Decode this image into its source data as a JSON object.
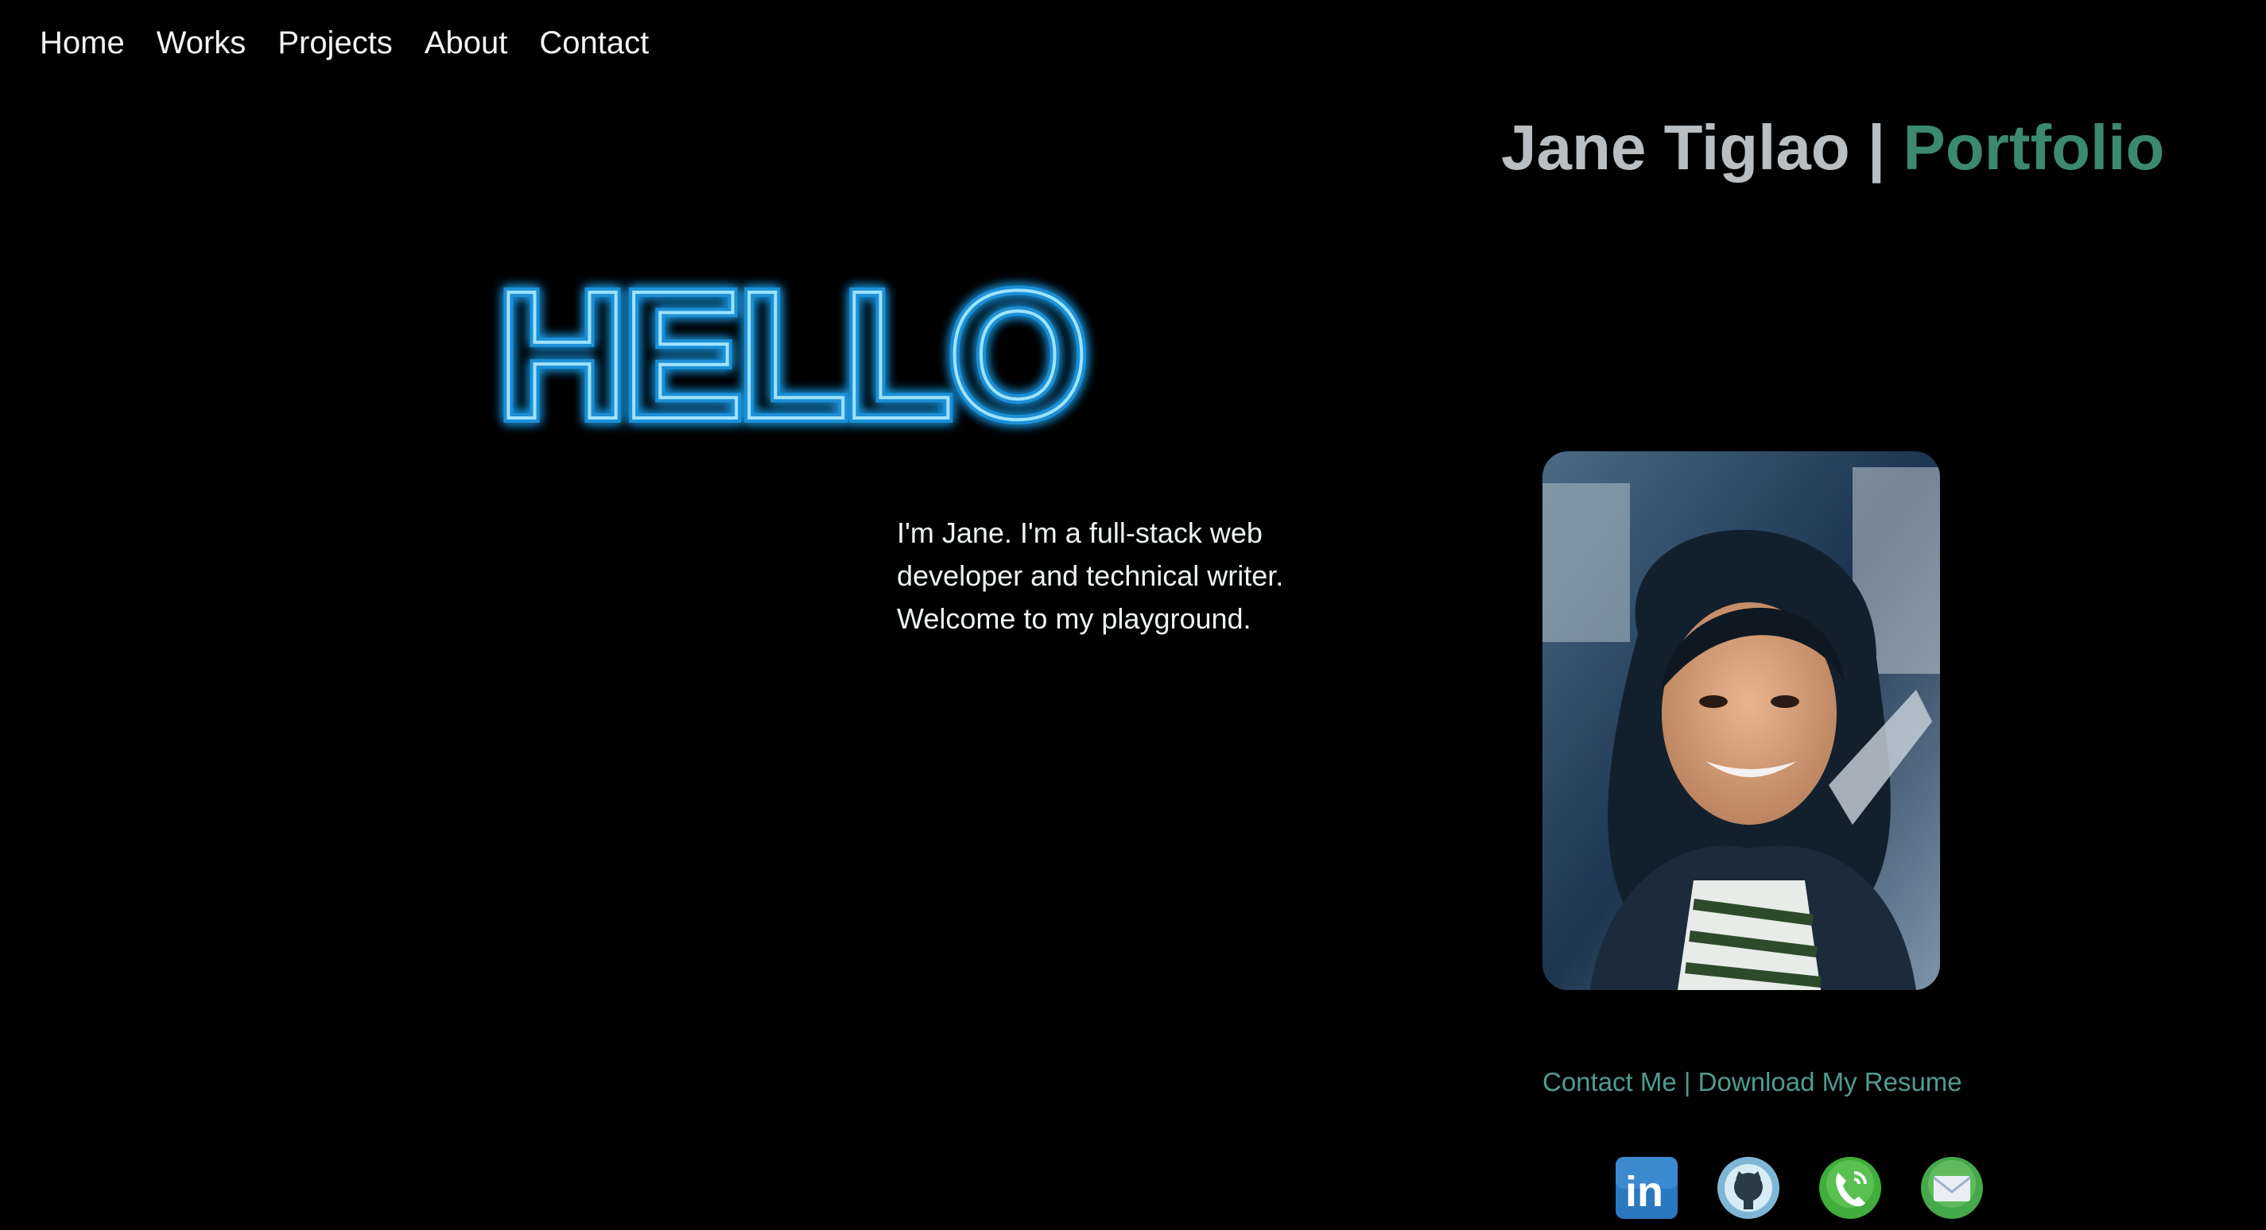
{
  "nav": {
    "items": [
      "Home",
      "Works",
      "Projects",
      "About",
      "Contact"
    ]
  },
  "brand": {
    "name": "Jane Tiglao",
    "separator": "|",
    "accent": "Portfolio",
    "accent_color": "#3b8a70"
  },
  "hero": {
    "greeting": "HELLO",
    "intro": "I'm Jane. I'm a full-stack web developer and technical writer. Welcome to my playground."
  },
  "links": {
    "contact": "Contact Me",
    "separator": "|",
    "resume": "Download My Resume",
    "color": "#4e9c8f"
  },
  "socials": [
    {
      "name": "linkedin-icon",
      "label": "in"
    },
    {
      "name": "github-icon"
    },
    {
      "name": "phone-icon"
    },
    {
      "name": "mail-icon"
    }
  ]
}
